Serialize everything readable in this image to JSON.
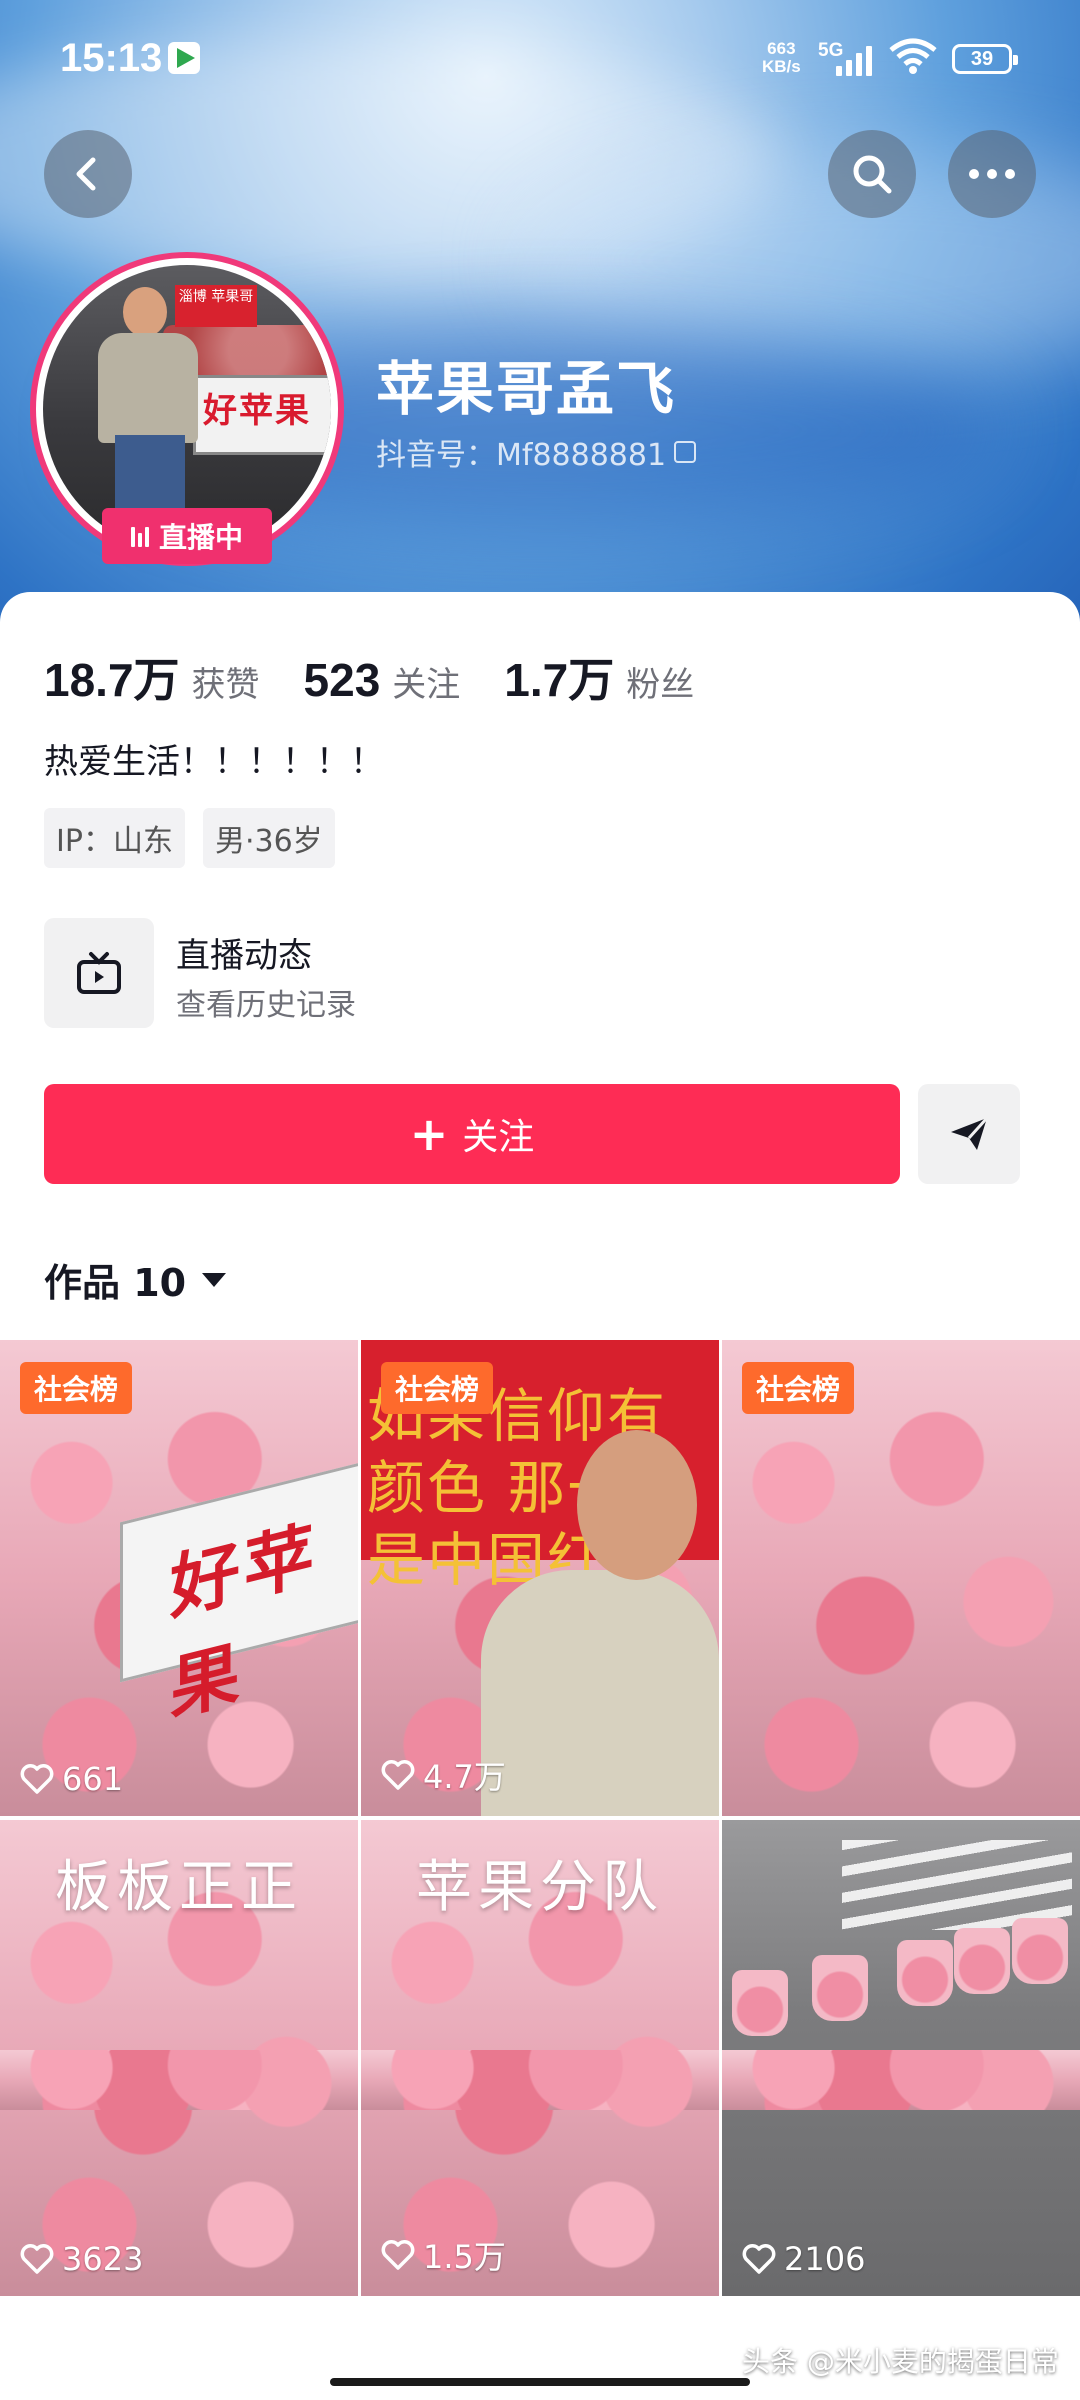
{
  "status_bar": {
    "time": "15:13",
    "net_speed": "663",
    "net_unit": "KB/s",
    "signal": "5G",
    "battery": "39"
  },
  "header": {
    "back_icon": "chevron-left-icon",
    "search_icon": "search-icon",
    "more_icon": "more-horizontal-icon"
  },
  "profile": {
    "name": "苹果哥孟飞",
    "douyin_id": "抖音号：Mf8888881",
    "live_badge": "直播中",
    "avatar_sign": "淄博 苹果哥",
    "avatar_stall_text": "好苹果"
  },
  "stats": [
    {
      "value": "18.7万",
      "label": "获赞"
    },
    {
      "value": "523",
      "label": "关注"
    },
    {
      "value": "1.7万",
      "label": "粉丝"
    }
  ],
  "bio": "热爱生活！！！！！！",
  "tags": [
    "IP：山东",
    "男·36岁"
  ],
  "live_entry": {
    "title": "直播动态",
    "subtitle": "查看历史记录"
  },
  "actions": {
    "follow_label": "关注",
    "share_icon": "send-icon"
  },
  "works_tab": {
    "label": "作品 10"
  },
  "videos": [
    {
      "badge": "社会榜",
      "likes": "661",
      "caption": "",
      "banner": "好苹果"
    },
    {
      "badge": "社会榜",
      "likes": "4.7万",
      "caption": "",
      "banner": "如果信仰有颜色 那一定是中国红"
    },
    {
      "badge": "社会榜",
      "likes": "",
      "caption": ""
    },
    {
      "badge": "",
      "likes": "3623",
      "caption": "板板正正"
    },
    {
      "badge": "",
      "likes": "1.5万",
      "caption": "苹果分队"
    },
    {
      "badge": "",
      "likes": "2106",
      "caption": ""
    }
  ],
  "watermark": "头条 @米小麦的揭蛋日常"
}
